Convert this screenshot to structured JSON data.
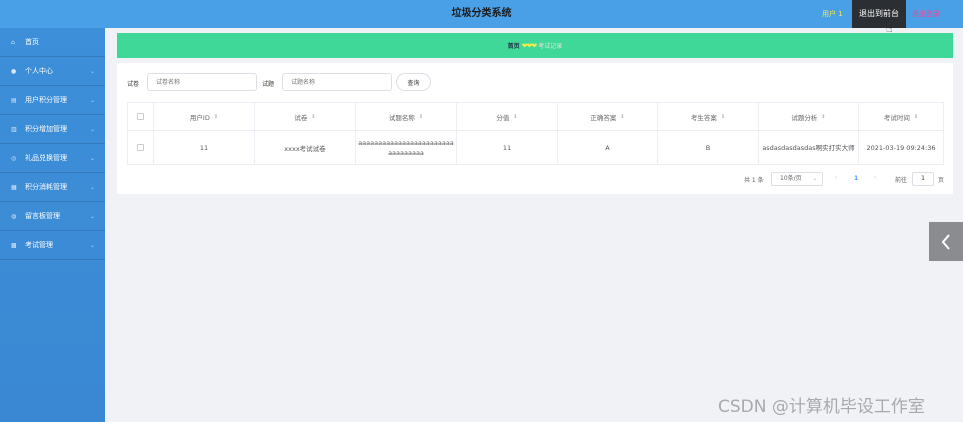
{
  "header": {
    "title": "垃圾分类系统",
    "user_label": "用户 1",
    "goto_admin": "退出到前台",
    "logout": "退出登录"
  },
  "sidebar": {
    "items": [
      {
        "label": "首页",
        "icon": "home-icon"
      },
      {
        "label": "个人中心",
        "icon": "user-icon"
      },
      {
        "label": "用户积分管理",
        "icon": "list-icon"
      },
      {
        "label": "积分增加管理",
        "icon": "list-icon"
      },
      {
        "label": "礼品兑换管理",
        "icon": "gift-icon"
      },
      {
        "label": "积分消耗管理",
        "icon": "list-icon"
      },
      {
        "label": "留言板管理",
        "icon": "message-icon"
      },
      {
        "label": "考试管理",
        "icon": "grid-icon"
      }
    ]
  },
  "breadcrumb": {
    "home": "首页",
    "current": "考试记录"
  },
  "search": {
    "label1": "试卷",
    "placeholder1": "试卷名称",
    "label2": "试题",
    "placeholder2": "试题名称",
    "button": "查询"
  },
  "table": {
    "columns": [
      "用户ID",
      "试卷",
      "试题名称",
      "分值",
      "正确答案",
      "考生答案",
      "试题分析",
      "考试时间"
    ],
    "rows": [
      {
        "user_id": "11",
        "paper": "xxxx考试试卷",
        "question": "aaaaaaaaaaaaaaaaaaaaaaaaaaaaaaaaa",
        "score": "11",
        "correct_answer": "A",
        "student_answer": "B",
        "analysis": "asdasdasdasdas啊实打实大师",
        "exam_time": "2021-03-19 09:24:36"
      }
    ]
  },
  "pagination": {
    "total": "共 1 条",
    "page_size": "10条/页",
    "current_page": "1",
    "goto_label": "前往",
    "goto_value": "1",
    "page_suffix": "页"
  },
  "watermark": "CSDN @计算机毕设工作室",
  "colors": {
    "header_bg": "#4aa0e6",
    "sidebar_bg": "#3d8fd9",
    "breadcrumb_bg": "#3fd898",
    "accent": "#409eff"
  }
}
